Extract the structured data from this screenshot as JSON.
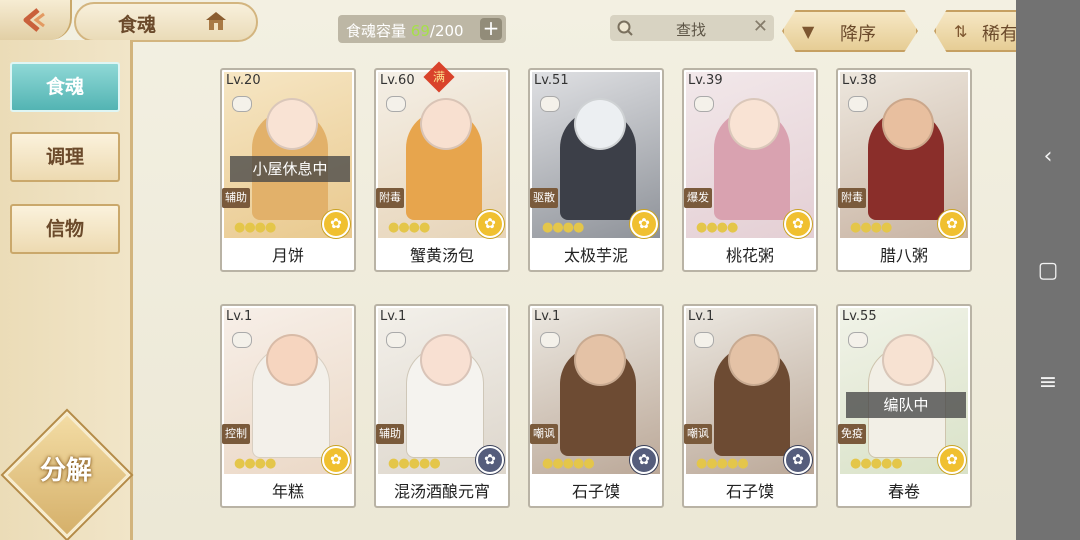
{
  "header": {
    "title": "食魂",
    "capacity_label": "食魂容量",
    "capacity_current": "69",
    "capacity_sep_max": "/200",
    "add_label": "+",
    "search_placeholder": "查找",
    "sort_order_label": "降序",
    "sort_key_label": "稀有度"
  },
  "sidebar": {
    "items": [
      {
        "label": "食魂",
        "active": true
      },
      {
        "label": "调理",
        "active": false
      },
      {
        "label": "信物",
        "active": false
      }
    ],
    "decompose_label": "分解"
  },
  "cards": [
    {
      "level": "Lv.20",
      "role": "辅助",
      "name": "月饼",
      "status": "小屋休息中",
      "stars": 4,
      "medal": "gold"
    },
    {
      "level": "Lv.60",
      "role": "附毒",
      "name": "蟹黄汤包",
      "badge": "满",
      "stars": 4,
      "medal": "gold"
    },
    {
      "level": "Lv.51",
      "role": "驱散",
      "name": "太极芋泥",
      "stars": 4,
      "medal": "gold"
    },
    {
      "level": "Lv.39",
      "role": "爆发",
      "name": "桃花粥",
      "stars": 4,
      "medal": "gold"
    },
    {
      "level": "Lv.38",
      "role": "附毒",
      "name": "腊八粥",
      "stars": 4,
      "medal": "gold"
    },
    {
      "level": "Lv.1",
      "role": "控制",
      "name": "年糕",
      "stars": 4,
      "medal": "gold"
    },
    {
      "level": "Lv.1",
      "role": "辅助",
      "name": "混汤酒酿元宵",
      "stars": 5,
      "medal": "dark"
    },
    {
      "level": "Lv.1",
      "role": "嘲讽",
      "name": "石子馍",
      "stars": 5,
      "medal": "dark"
    },
    {
      "level": "Lv.1",
      "role": "嘲讽",
      "name": "石子馍",
      "stars": 5,
      "medal": "dark"
    },
    {
      "level": "Lv.55",
      "role": "免疫",
      "name": "春卷",
      "status": "编队中",
      "stars": 5,
      "medal": "gold"
    }
  ],
  "colors": {
    "accent_teal": "#53b4b3",
    "capacity_green": "#a6e04a",
    "gold": "#f0c030"
  },
  "system_nav": {
    "icons": [
      "back-icon",
      "home-icon",
      "menu-icon"
    ]
  }
}
